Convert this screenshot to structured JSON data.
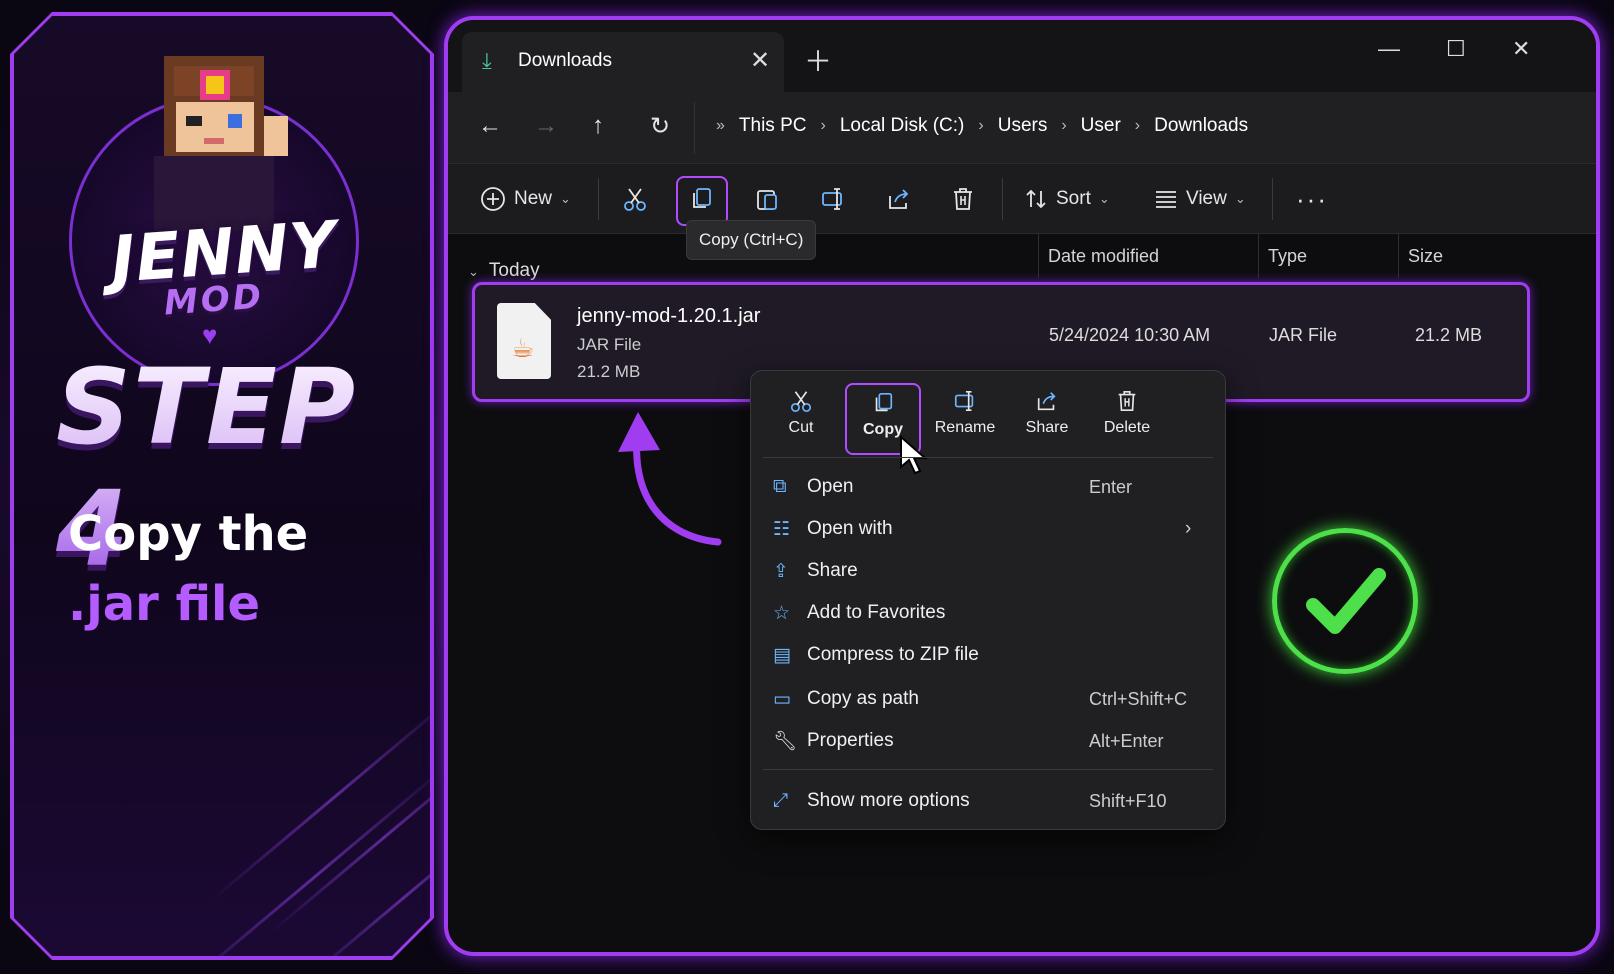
{
  "promo": {
    "logo_title": "JENNY",
    "logo_sub": "MOD",
    "step_title": "STEP 4",
    "desc_line1": "Copy the",
    "desc_line2": ".jar file"
  },
  "window": {
    "tab_title": "Downloads",
    "breadcrumbs": [
      "This PC",
      "Local Disk (C:)",
      "Users",
      "User",
      "Downloads"
    ],
    "toolbar": {
      "new_label": "New",
      "sort_label": "Sort",
      "view_label": "View",
      "tooltip": "Copy (Ctrl+C)"
    },
    "columns": {
      "date": "Date modified",
      "type": "Type",
      "size": "Size"
    },
    "group_label": "Today",
    "file": {
      "name": "jenny-mod-1.20.1.jar",
      "type": "JAR File",
      "size": "21.2 MB",
      "date": "5/24/2024 10:30 AM",
      "type_col": "JAR File",
      "size_col": "21.2 MB"
    }
  },
  "context_menu": {
    "quick_actions": [
      "Cut",
      "Copy",
      "Rename",
      "Share",
      "Delete"
    ],
    "items": [
      {
        "label": "Open",
        "shortcut": "Enter"
      },
      {
        "label": "Open with",
        "shortcut": ""
      },
      {
        "label": "Share",
        "shortcut": ""
      },
      {
        "label": "Add to Favorites",
        "shortcut": ""
      },
      {
        "label": "Compress to ZIP file",
        "shortcut": ""
      },
      {
        "label": "Copy as path",
        "shortcut": "Ctrl+Shift+C"
      },
      {
        "label": "Properties",
        "shortcut": "Alt+Enter"
      }
    ],
    "more": {
      "label": "Show more options",
      "shortcut": "Shift+F10"
    }
  },
  "colors": {
    "accent": "#a13df0",
    "check": "#4ee04a"
  }
}
